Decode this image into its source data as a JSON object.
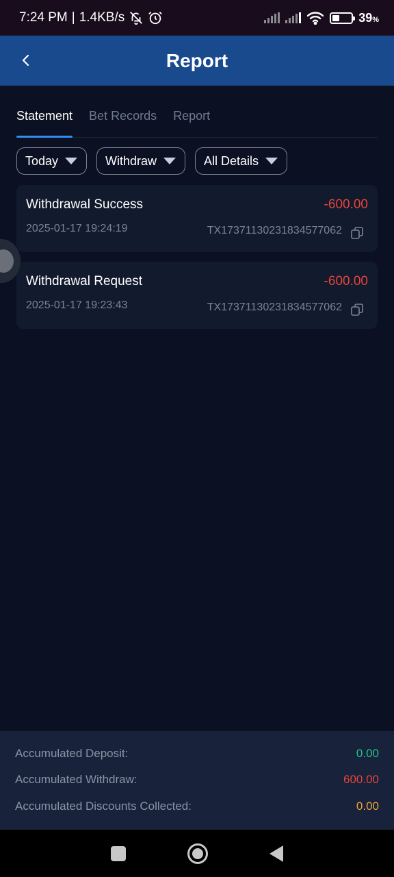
{
  "status_bar": {
    "time": "7:24 PM",
    "separator": "|",
    "speed": "1.4KB/s",
    "battery_percent": "39",
    "battery_unit": "%",
    "battery_level": 0.39
  },
  "header": {
    "title": "Report",
    "back_icon": "chevron-left-icon"
  },
  "tabs": [
    {
      "label": "Statement",
      "active": true
    },
    {
      "label": "Bet Records",
      "active": false
    },
    {
      "label": "Report",
      "active": false
    }
  ],
  "filters": [
    {
      "label": "Today"
    },
    {
      "label": "Withdraw"
    },
    {
      "label": "All Details"
    }
  ],
  "records": [
    {
      "title": "Withdrawal Success",
      "amount": "-600.00",
      "time": "2025-01-17 19:24:19",
      "tx": "TX17371130231834577062"
    },
    {
      "title": "Withdrawal Request",
      "amount": "-600.00",
      "time": "2025-01-17 19:23:43",
      "tx": "TX17371130231834577062"
    }
  ],
  "summary": {
    "deposit_label": "Accumulated Deposit:",
    "deposit_value": "0.00",
    "withdraw_label": "Accumulated Withdraw:",
    "withdraw_value": "600.00",
    "discounts_label": "Accumulated Discounts Collected:",
    "discounts_value": "0.00"
  },
  "colors": {
    "header_bg": "#1a4a8e",
    "negative": "#e5453a",
    "positive": "#1fc98a",
    "discount": "#f0a338",
    "tab_active_underline": "#2f8ff0"
  }
}
